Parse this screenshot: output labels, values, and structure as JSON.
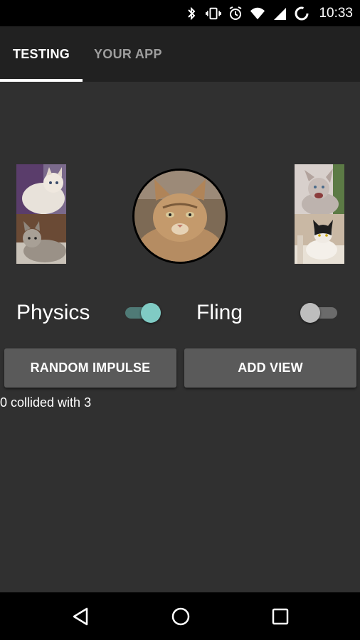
{
  "status_bar": {
    "time": "10:33",
    "icons": [
      "bluetooth-icon",
      "vibrate-icon",
      "alarm-icon",
      "wifi-icon",
      "signal-icon",
      "battery-icon"
    ]
  },
  "tabs": [
    {
      "label": "TESTING",
      "active": true
    },
    {
      "label": "YOUR APP",
      "active": false
    }
  ],
  "controls": {
    "physics": {
      "label": "Physics",
      "on": true
    },
    "fling": {
      "label": "Fling",
      "on": false
    }
  },
  "buttons": {
    "random_impulse": "RANDOM IMPULSE",
    "add_view": "ADD VIEW"
  },
  "collision_text": "0 collided with 3",
  "colors": {
    "background": "#303030",
    "tabbar": "#212121",
    "switch_on_thumb": "#80cbc4",
    "switch_on_track": "#4f7a76",
    "switch_off_thumb": "#bdbdbd",
    "switch_off_track": "#6b6b6b",
    "button": "#5a5a5a"
  },
  "nav": [
    "back-icon",
    "home-icon",
    "recents-icon"
  ]
}
